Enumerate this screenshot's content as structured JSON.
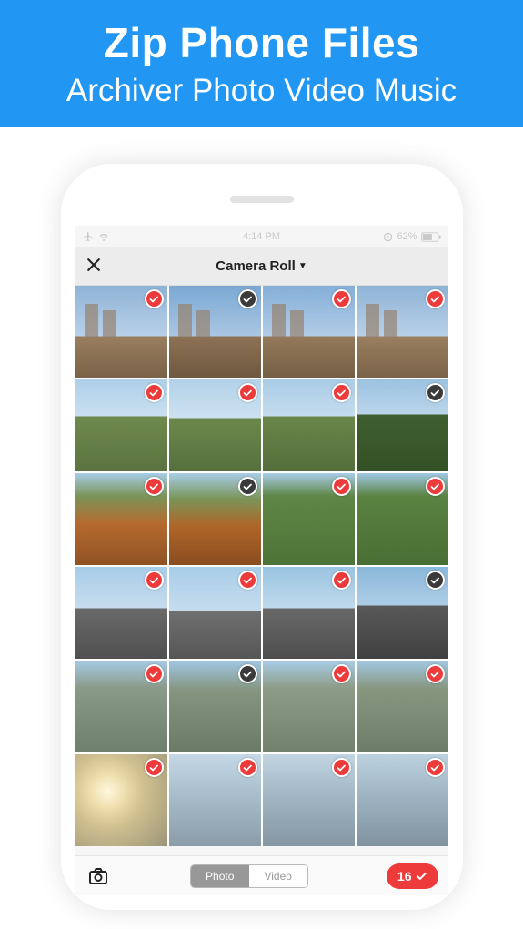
{
  "banner": {
    "title": "Zip Phone Files",
    "subtitle": "Archiver Photo Video Music"
  },
  "statusbar": {
    "time": "4:14 PM",
    "battery": "62%"
  },
  "navbar": {
    "title": "Camera Roll"
  },
  "segmented": {
    "photo": "Photo",
    "video": "Video"
  },
  "selection": {
    "count": "16"
  },
  "photos": [
    {
      "thumb_class": "sky-bldg-1 towers",
      "selected": true,
      "color": "red"
    },
    {
      "thumb_class": "sky-bldg-2 towers",
      "selected": false,
      "color": "dark"
    },
    {
      "thumb_class": "sky-bldg-3 towers",
      "selected": true,
      "color": "red"
    },
    {
      "thumb_class": "sky-bldg-4 towers",
      "selected": true,
      "color": "red"
    },
    {
      "thumb_class": "park-1",
      "selected": true,
      "color": "red"
    },
    {
      "thumb_class": "park-2",
      "selected": true,
      "color": "red"
    },
    {
      "thumb_class": "park-3",
      "selected": true,
      "color": "red"
    },
    {
      "thumb_class": "park-dark",
      "selected": false,
      "color": "dark"
    },
    {
      "thumb_class": "flowers-1",
      "selected": true,
      "color": "red"
    },
    {
      "thumb_class": "flowers-2",
      "selected": false,
      "color": "dark"
    },
    {
      "thumb_class": "grass-1",
      "selected": true,
      "color": "red"
    },
    {
      "thumb_class": "grass-2",
      "selected": true,
      "color": "red"
    },
    {
      "thumb_class": "street-1",
      "selected": true,
      "color": "red"
    },
    {
      "thumb_class": "street-2",
      "selected": true,
      "color": "red"
    },
    {
      "thumb_class": "street-3",
      "selected": true,
      "color": "red"
    },
    {
      "thumb_class": "street-dark",
      "selected": false,
      "color": "dark"
    },
    {
      "thumb_class": "bldg-tall-1",
      "selected": true,
      "color": "red"
    },
    {
      "thumb_class": "bldg-tall-2",
      "selected": false,
      "color": "dark"
    },
    {
      "thumb_class": "bldg-tall-3",
      "selected": true,
      "color": "red"
    },
    {
      "thumb_class": "bldg-tall-4",
      "selected": true,
      "color": "red"
    },
    {
      "thumb_class": "sunset-1",
      "selected": true,
      "color": "red"
    },
    {
      "thumb_class": "modern-1",
      "selected": true,
      "color": "red"
    },
    {
      "thumb_class": "modern-2",
      "selected": true,
      "color": "red"
    },
    {
      "thumb_class": "modern-3",
      "selected": true,
      "color": "red"
    }
  ]
}
